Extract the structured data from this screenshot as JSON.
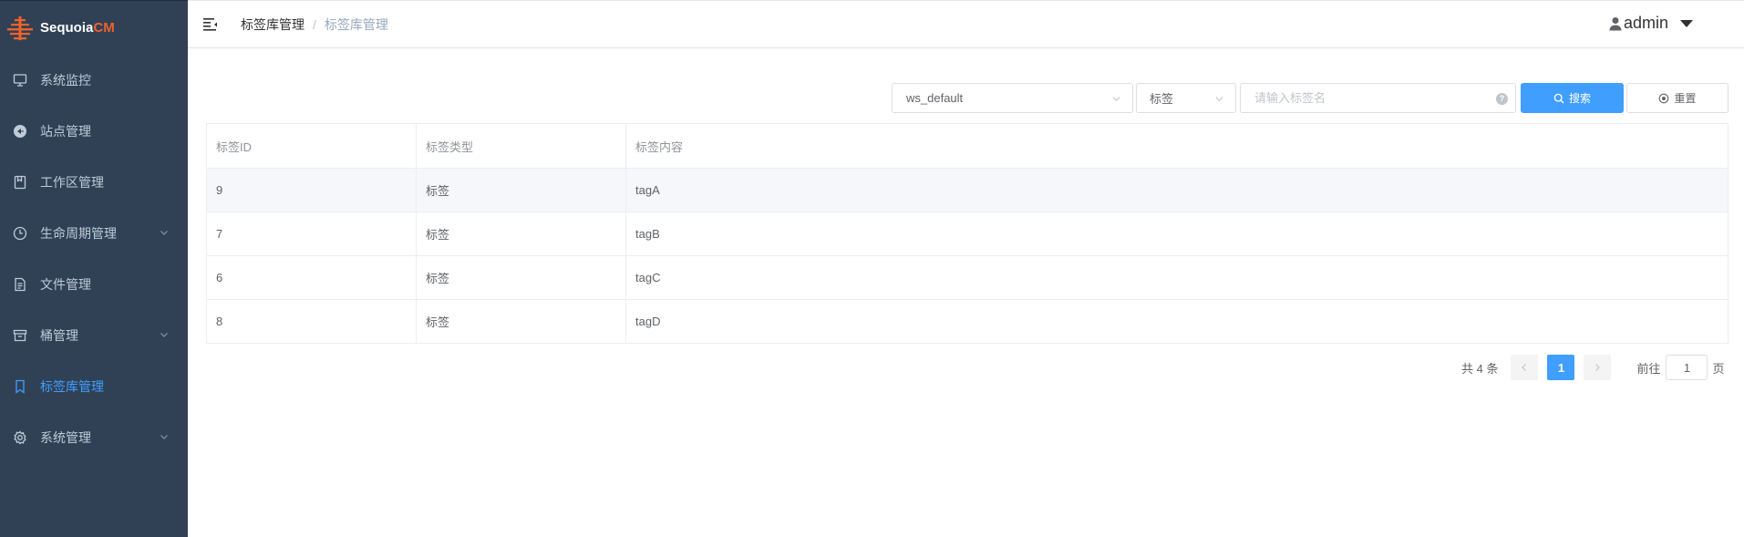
{
  "app": {
    "logo_text_main": "Sequoia",
    "logo_text_accent": "CM",
    "accent_color": "#409eff",
    "sidebar_bg": "#304156",
    "brand_color": "#f0622a"
  },
  "sidebar": {
    "items": [
      {
        "label": "系统监控",
        "icon": "monitor-icon",
        "has_submenu": false,
        "active": false
      },
      {
        "label": "站点管理",
        "icon": "site-icon",
        "has_submenu": false,
        "active": false
      },
      {
        "label": "工作区管理",
        "icon": "workspace-icon",
        "has_submenu": false,
        "active": false
      },
      {
        "label": "生命周期管理",
        "icon": "clock-icon",
        "has_submenu": true,
        "active": false
      },
      {
        "label": "文件管理",
        "icon": "file-icon",
        "has_submenu": false,
        "active": false
      },
      {
        "label": "桶管理",
        "icon": "bucket-icon",
        "has_submenu": true,
        "active": false
      },
      {
        "label": "标签库管理",
        "icon": "bookmark-icon",
        "has_submenu": false,
        "active": true
      },
      {
        "label": "系统管理",
        "icon": "gear-icon",
        "has_submenu": true,
        "active": false
      }
    ]
  },
  "header": {
    "breadcrumb": [
      "标签库管理",
      "标签库管理"
    ],
    "separator": "/",
    "user": "admin"
  },
  "filter": {
    "workspace_value": "ws_default",
    "type_value": "标签",
    "search_placeholder": "请输入标签名",
    "help_glyph": "?",
    "search_label": "搜索",
    "reset_label": "重置"
  },
  "table": {
    "columns": [
      "标签ID",
      "标签类型",
      "标签内容"
    ],
    "rows": [
      {
        "id": "9",
        "type": "标签",
        "content": "tagA"
      },
      {
        "id": "7",
        "type": "标签",
        "content": "tagB"
      },
      {
        "id": "6",
        "type": "标签",
        "content": "tagC"
      },
      {
        "id": "8",
        "type": "标签",
        "content": "tagD"
      }
    ]
  },
  "pagination": {
    "total_text": "共 4 条",
    "current_page": "1",
    "goto_label": "前往",
    "goto_value": "1",
    "page_suffix": "页"
  }
}
